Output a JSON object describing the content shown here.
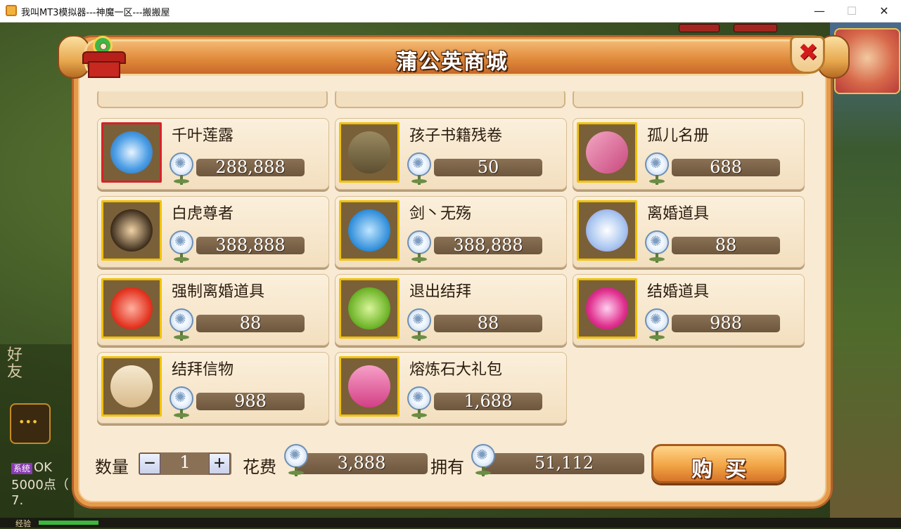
{
  "window": {
    "title": "我叫MT3模拟器---神魔一区---搬搬屋",
    "minimize": "—",
    "maximize": "☐",
    "close": "✕"
  },
  "dialog": {
    "title": "蒲公英商城",
    "close_icon": "✖"
  },
  "items": [
    {
      "name": "千叶莲露",
      "price": "288,888",
      "icon": "blue-vase-icon",
      "frame": "#d4232a"
    },
    {
      "name": "孩子书籍残卷",
      "price": "50",
      "icon": "book-chest-icon",
      "frame": "#f1c20a"
    },
    {
      "name": "孤儿名册",
      "price": "688",
      "icon": "pink-book-icon",
      "frame": "#f1c20a"
    },
    {
      "name": "白虎尊者",
      "price": "388,888",
      "icon": "warrior-portrait-icon",
      "frame": "#f1c20a"
    },
    {
      "name": "剑丶无殇",
      "price": "388,888",
      "icon": "ice-warrior-icon",
      "frame": "#f1c20a"
    },
    {
      "name": "离婚道具",
      "price": "88",
      "icon": "broken-ring-icon",
      "frame": "#f1c20a"
    },
    {
      "name": "强制离婚道具",
      "price": "88",
      "icon": "heart-sword-icon",
      "frame": "#f1c20a"
    },
    {
      "name": "退出结拜",
      "price": "88",
      "icon": "green-heart-pendant-icon",
      "frame": "#f1c20a"
    },
    {
      "name": "结婚道具",
      "price": "988",
      "icon": "pink-gem-heart-icon",
      "frame": "#f1c20a"
    },
    {
      "name": "结拜信物",
      "price": "988",
      "icon": "scroll-icon",
      "frame": "#f1c20a"
    },
    {
      "name": "熔炼石大礼包",
      "price": "1,688",
      "icon": "gift-box-icon",
      "frame": "#f1c20a"
    }
  ],
  "purchase": {
    "qty_label": "数量",
    "qty_minus": "−",
    "qty_value": "1",
    "qty_plus": "+",
    "cost_label": "花费",
    "cost_value": "3,888",
    "own_label": "拥有",
    "own_value": "51,112",
    "buy_label": "购买"
  },
  "side": {
    "friend_label": "好友",
    "sys_badge": "系统",
    "sys_line1": "OK",
    "sys_line2": "5000点（",
    "sys_line3": "7.",
    "exp_label": "经验"
  },
  "currency_icon": "dandelion-icon",
  "colors": {
    "accent_orange": "#e08a3b",
    "panel_bg": "#f8ead3",
    "price_bar": "#6d563d",
    "close_red": "#d21c1c"
  }
}
